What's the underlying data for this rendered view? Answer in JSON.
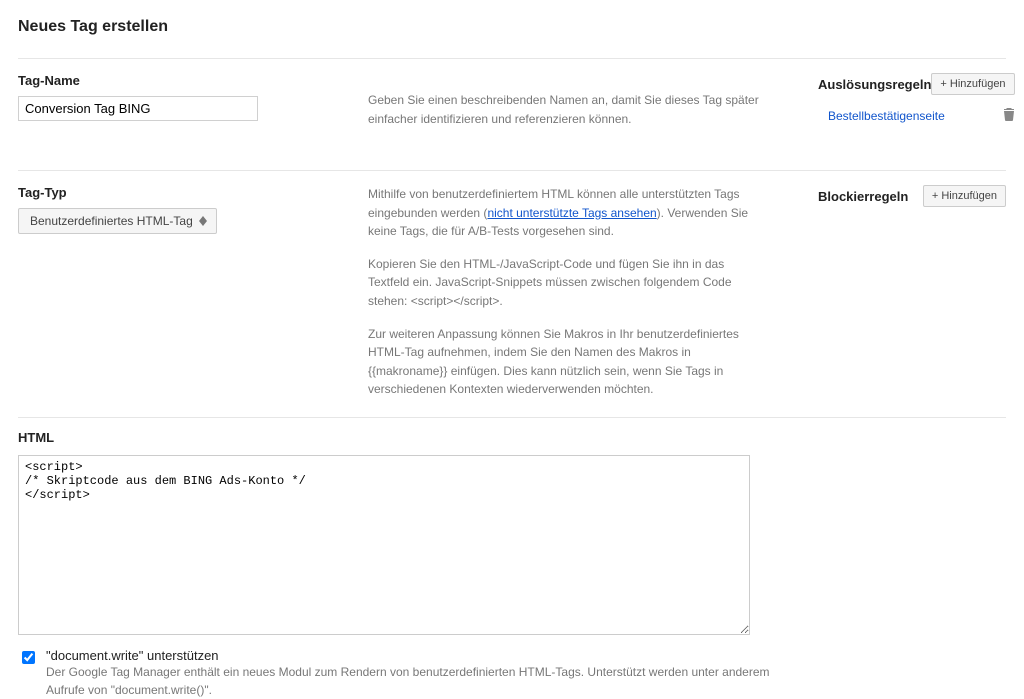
{
  "page_title": "Neues Tag erstellen",
  "tag_name": {
    "label": "Tag-Name",
    "value": "Conversion Tag BING",
    "help": "Geben Sie einen beschreibenden Namen an, damit Sie dieses Tag später einfacher identifizieren und referenzieren können."
  },
  "tag_type": {
    "label": "Tag-Typ",
    "selected": "Benutzerdefiniertes HTML-Tag",
    "help_p1_pre": "Mithilfe von benutzerdefiniertem HTML können alle unterstützten Tags eingebunden werden (",
    "help_p1_link": "nicht unterstützte Tags ansehen",
    "help_p1_post": "). Verwenden Sie keine Tags, die für A/B-Tests vorgesehen sind.",
    "help_p2": "Kopieren Sie den HTML-/JavaScript-Code und fügen Sie ihn in das Textfeld ein. JavaScript-Snippets müssen zwischen folgendem Code stehen: <script></script>.",
    "help_p3": "Zur weiteren Anpassung können Sie Makros in Ihr benutzerdefiniertes HTML-Tag aufnehmen, indem Sie den Namen des Makros in {{makroname}} einfügen. Dies kann nützlich sein, wenn Sie Tags in verschiedenen Kontexten wiederverwenden möchten."
  },
  "sidebar": {
    "firing_rules": {
      "title": "Auslösungsregeln",
      "add_label": "+ Hinzufügen",
      "items": [
        {
          "label": "Bestellbestätigenseite"
        }
      ]
    },
    "blocking_rules": {
      "title": "Blockierregeln",
      "add_label": "+ Hinzufügen"
    }
  },
  "html": {
    "label": "HTML",
    "value": "<script>\n/* Skriptcode aus dem BING Ads-Konto */\n</script>",
    "docwrite_label": "\"document.write\" unterstützen",
    "docwrite_help": "Der Google Tag Manager enthält ein neues Modul zum Rendern von benutzerdefinierten HTML-Tags. Unterstützt werden unter anderem Aufrufe von \"document.write()\".",
    "docwrite_checked": true
  }
}
